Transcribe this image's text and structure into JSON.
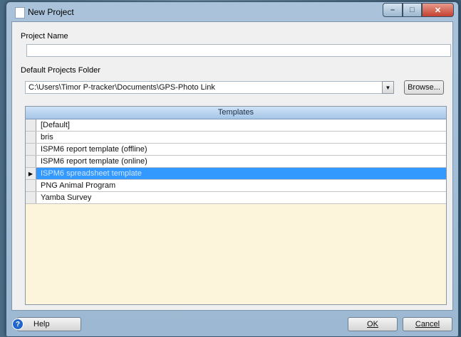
{
  "window": {
    "title": "New Project",
    "buttons": {
      "minimize": "–",
      "maximize": "□",
      "close": "✕"
    }
  },
  "project_name": {
    "label": "Project Name",
    "value": ""
  },
  "default_folder": {
    "label": "Default Projects Folder",
    "value": "C:\\Users\\Timor P-tracker\\Documents\\GPS-Photo Link",
    "browse_label": "Browse...",
    "dropdown_icon": "▼"
  },
  "templates": {
    "header": "Templates",
    "selected_indicator": "▶",
    "rows": [
      {
        "name": "[Default]",
        "selected": false
      },
      {
        "name": "bris",
        "selected": false
      },
      {
        "name": "ISPM6 report template (offline)",
        "selected": false
      },
      {
        "name": "ISPM6 report template (online)",
        "selected": false
      },
      {
        "name": "ISPM6 spreadsheet template",
        "selected": true
      },
      {
        "name": "PNG Animal Program",
        "selected": false
      },
      {
        "name": "Yamba Survey",
        "selected": false
      }
    ]
  },
  "footer": {
    "help_label": "Help",
    "help_icon": "?",
    "ok_label": "OK",
    "cancel_label": "Cancel"
  }
}
